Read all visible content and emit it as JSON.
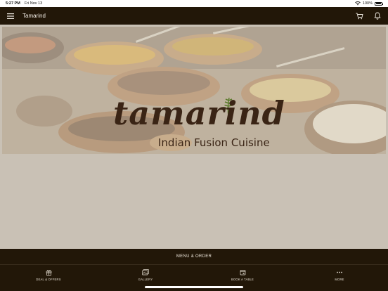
{
  "status_bar": {
    "time": "5:27 PM",
    "date": "Fri Nov 13",
    "battery": "100%"
  },
  "navbar": {
    "title": "Tamarind",
    "icons": [
      "hamburger-menu-icon",
      "cart-icon",
      "bell-icon"
    ]
  },
  "hero": {
    "brand": "tamarind",
    "tagline": "Indian Fusion Cuisine"
  },
  "menu_order": {
    "label": "MENU & ORDER"
  },
  "tabs": [
    {
      "label": "DEAL & OFFERS",
      "icon": "gift-icon"
    },
    {
      "label": "GALLERY",
      "icon": "gallery-icon"
    },
    {
      "label": "BOOK A TABLE",
      "icon": "calendar-icon"
    },
    {
      "label": "MORE",
      "icon": "more-dots-icon"
    }
  ],
  "colors": {
    "bar": "#221708",
    "background": "#c9c1b5",
    "logo": "#3a2415",
    "leaf": "#5a7a2a"
  }
}
